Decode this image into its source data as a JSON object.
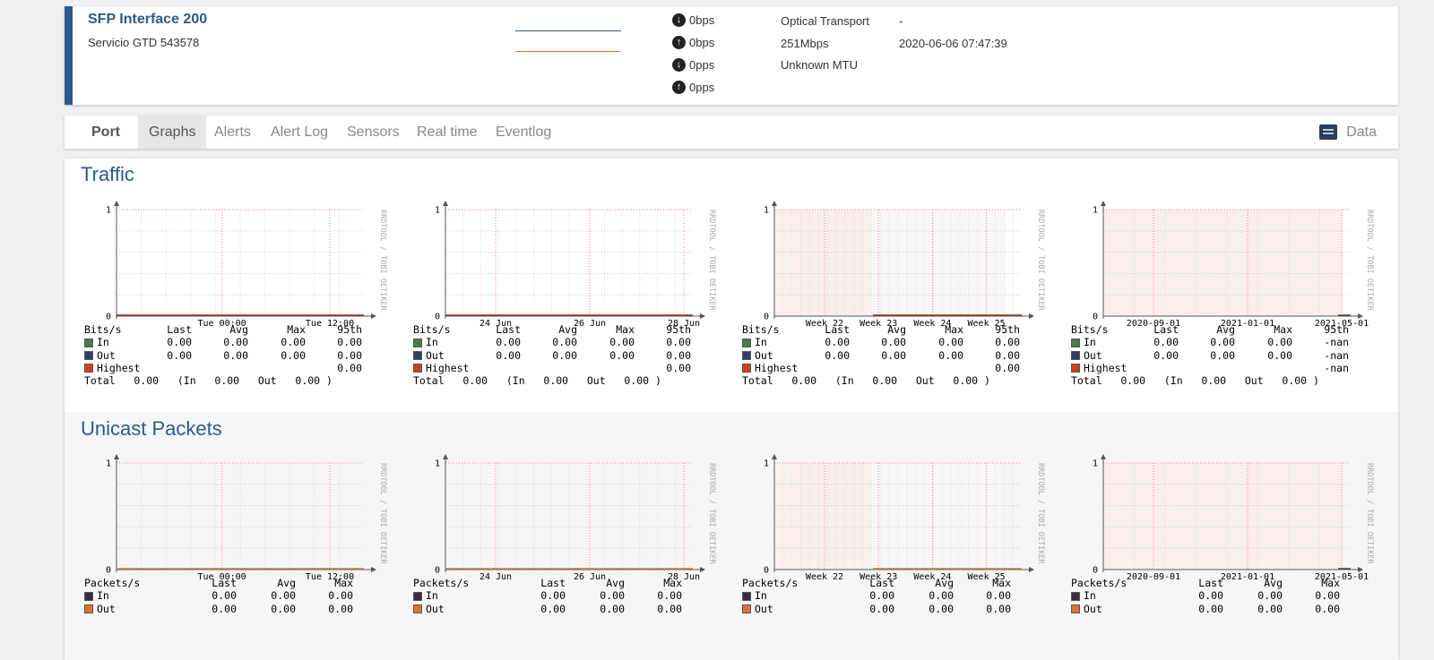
{
  "port": {
    "name": "SFP Interface 200",
    "description": "Servicio GTD 543578",
    "in_bps": "0bps",
    "out_bps": "0bps",
    "in_pps": "0pps",
    "out_pps": "0pps",
    "type": "Optical Transport",
    "speed": "251Mbps",
    "mtu": "Unknown MTU",
    "dash": "-",
    "last_change": "2020-06-06 07:47:39",
    "spark_in_color": "#3c5a8a",
    "spark_out_color": "#e08040"
  },
  "tabs": {
    "port": "Port",
    "graphs": "Graphs",
    "alerts": "Alerts",
    "alert_log": "Alert Log",
    "sensors": "Sensors",
    "real_time": "Real time",
    "eventlog": "Eventlog",
    "data": "Data"
  },
  "sections": {
    "traffic": "Traffic",
    "unicast": "Unicast Packets"
  },
  "watermark": "RRDTOOL / TOBI OETIKER",
  "chart_data": [
    {
      "type": "area",
      "group": "Traffic",
      "period": "day",
      "x_ticks": [
        "Tue 00:00",
        "Tue 12:00"
      ],
      "ylim": [
        0,
        1
      ],
      "y_ticks": [
        "0",
        "1"
      ],
      "series": [
        {
          "name": "In",
          "values": [
            0
          ]
        },
        {
          "name": "Out",
          "values": [
            0
          ]
        }
      ],
      "legend": {
        "header": [
          "Bits/s",
          "Last",
          "Avg",
          "Max",
          "95th"
        ],
        "rows": [
          {
            "label": "In",
            "values": [
              "0.00",
              "0.00",
              "0.00",
              "0.00"
            ]
          },
          {
            "label": "Out",
            "values": [
              "0.00",
              "0.00",
              "0.00",
              "0.00"
            ]
          },
          {
            "label": "Highest",
            "values": [
              "",
              "",
              "",
              "0.00"
            ]
          }
        ],
        "total": "Total   0.00   (In   0.00   Out   0.00 )"
      }
    },
    {
      "type": "area",
      "group": "Traffic",
      "period": "week",
      "x_ticks": [
        "24 Jun",
        "26 Jun",
        "28 Jun"
      ],
      "ylim": [
        0,
        1
      ],
      "y_ticks": [
        "0",
        "1"
      ],
      "series": [
        {
          "name": "In",
          "values": [
            0
          ]
        },
        {
          "name": "Out",
          "values": [
            0
          ]
        }
      ],
      "legend": {
        "header": [
          "Bits/s",
          "Last",
          "Avg",
          "Max",
          "95th"
        ],
        "rows": [
          {
            "label": "In",
            "values": [
              "0.00",
              "0.00",
              "0.00",
              "0.00"
            ]
          },
          {
            "label": "Out",
            "values": [
              "0.00",
              "0.00",
              "0.00",
              "0.00"
            ]
          },
          {
            "label": "Highest",
            "values": [
              "",
              "",
              "",
              "0.00"
            ]
          }
        ],
        "total": "Total   0.00   (In   0.00   Out   0.00 )"
      }
    },
    {
      "type": "area",
      "group": "Traffic",
      "period": "month",
      "x_ticks": [
        "Week 22",
        "Week 23",
        "Week 24",
        "Week 25"
      ],
      "ylim": [
        0,
        1
      ],
      "y_ticks": [
        "0",
        "1"
      ],
      "series": [
        {
          "name": "In",
          "values": [
            0
          ]
        },
        {
          "name": "Out",
          "values": [
            0
          ]
        }
      ],
      "legend": {
        "header": [
          "Bits/s",
          "Last",
          "Avg",
          "Max",
          "95th"
        ],
        "rows": [
          {
            "label": "In",
            "values": [
              "0.00",
              "0.00",
              "0.00",
              "0.00"
            ]
          },
          {
            "label": "Out",
            "values": [
              "0.00",
              "0.00",
              "0.00",
              "0.00"
            ]
          },
          {
            "label": "Highest",
            "values": [
              "",
              "",
              "",
              "0.00"
            ]
          }
        ],
        "total": "Total   0.00   (In   0.00   Out   0.00 )"
      }
    },
    {
      "type": "area",
      "group": "Traffic",
      "period": "year",
      "x_ticks": [
        "2020-09-01",
        "2021-01-01",
        "2021-05-01"
      ],
      "ylim": [
        0,
        1
      ],
      "y_ticks": [
        "0",
        "1"
      ],
      "series": [
        {
          "name": "In",
          "values": [
            0
          ]
        },
        {
          "name": "Out",
          "values": [
            0
          ]
        }
      ],
      "legend": {
        "header": [
          "Bits/s",
          "Last",
          "Avg",
          "Max",
          "95th"
        ],
        "rows": [
          {
            "label": "In",
            "values": [
              "0.00",
              "0.00",
              "0.00",
              "-nan"
            ]
          },
          {
            "label": "Out",
            "values": [
              "0.00",
              "0.00",
              "0.00",
              "-nan"
            ]
          },
          {
            "label": "Highest",
            "values": [
              "",
              "",
              "",
              "-nan"
            ]
          }
        ],
        "total": "Total   0.00   (In   0.00   Out   0.00 )"
      }
    },
    {
      "type": "area",
      "group": "Unicast Packets",
      "period": "day",
      "x_ticks": [
        "Tue 00:00",
        "Tue 12:00"
      ],
      "ylim": [
        0,
        1
      ],
      "y_ticks": [
        "0",
        "1"
      ],
      "series": [
        {
          "name": "In",
          "values": [
            0
          ]
        },
        {
          "name": "Out",
          "values": [
            0
          ]
        }
      ],
      "legend": {
        "header": [
          "Packets/s",
          "Last",
          "Avg",
          "Max"
        ],
        "rows": [
          {
            "label": "In",
            "values": [
              "0.00",
              "0.00",
              "0.00"
            ]
          },
          {
            "label": "Out",
            "values": [
              "0.00",
              "0.00",
              "0.00"
            ]
          }
        ]
      }
    },
    {
      "type": "area",
      "group": "Unicast Packets",
      "period": "week",
      "x_ticks": [
        "24 Jun",
        "26 Jun",
        "28 Jun"
      ],
      "ylim": [
        0,
        1
      ],
      "y_ticks": [
        "0",
        "1"
      ],
      "series": [
        {
          "name": "In",
          "values": [
            0
          ]
        },
        {
          "name": "Out",
          "values": [
            0
          ]
        }
      ],
      "legend": {
        "header": [
          "Packets/s",
          "Last",
          "Avg",
          "Max"
        ],
        "rows": [
          {
            "label": "In",
            "values": [
              "0.00",
              "0.00",
              "0.00"
            ]
          },
          {
            "label": "Out",
            "values": [
              "0.00",
              "0.00",
              "0.00"
            ]
          }
        ]
      }
    },
    {
      "type": "area",
      "group": "Unicast Packets",
      "period": "month",
      "x_ticks": [
        "Week 22",
        "Week 23",
        "Week 24",
        "Week 25"
      ],
      "ylim": [
        0,
        1
      ],
      "y_ticks": [
        "0",
        "1"
      ],
      "series": [
        {
          "name": "In",
          "values": [
            0
          ]
        },
        {
          "name": "Out",
          "values": [
            0
          ]
        }
      ],
      "legend": {
        "header": [
          "Packets/s",
          "Last",
          "Avg",
          "Max"
        ],
        "rows": [
          {
            "label": "In",
            "values": [
              "0.00",
              "0.00",
              "0.00"
            ]
          },
          {
            "label": "Out",
            "values": [
              "0.00",
              "0.00",
              "0.00"
            ]
          }
        ]
      }
    },
    {
      "type": "area",
      "group": "Unicast Packets",
      "period": "year",
      "x_ticks": [
        "2020-09-01",
        "2021-01-01",
        "2021-05-01"
      ],
      "ylim": [
        0,
        1
      ],
      "y_ticks": [
        "0",
        "1"
      ],
      "series": [
        {
          "name": "In",
          "values": [
            0
          ]
        },
        {
          "name": "Out",
          "values": [
            0
          ]
        }
      ],
      "legend": {
        "header": [
          "Packets/s",
          "Last",
          "Avg",
          "Max"
        ],
        "rows": [
          {
            "label": "In",
            "values": [
              "0.00",
              "0.00",
              "0.00"
            ]
          },
          {
            "label": "Out",
            "values": [
              "0.00",
              "0.00",
              "0.00"
            ]
          }
        ]
      }
    }
  ],
  "colors": {
    "accent": "#2d5a8a",
    "bits_in": "#4a7a4a",
    "bits_out": "#2e3e66",
    "highest": "#d04020",
    "pkts_in": "#3a2a4a",
    "pkts_out": "#e07030"
  }
}
